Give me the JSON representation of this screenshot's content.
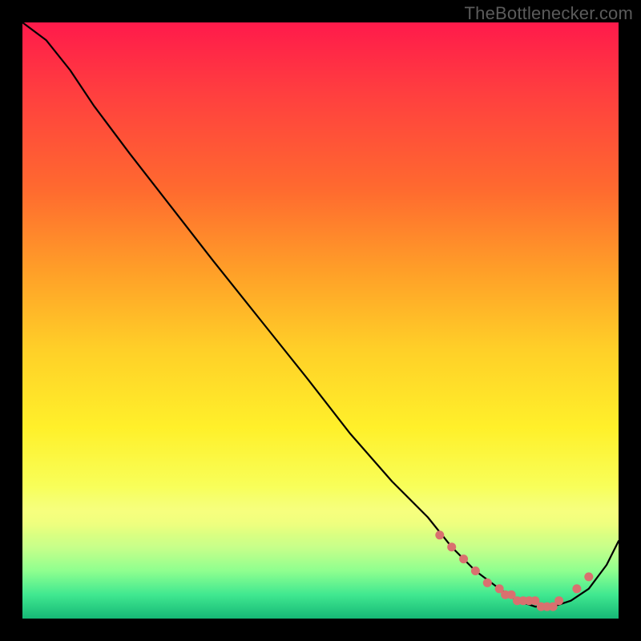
{
  "watermark": "TheBottlenecker.com",
  "chart_data": {
    "type": "line",
    "title": "",
    "xlabel": "",
    "ylabel": "",
    "xlim": [
      0,
      100
    ],
    "ylim": [
      0,
      100
    ],
    "grid": false,
    "series": [
      {
        "name": "curve",
        "x": [
          0,
          4,
          8,
          12,
          18,
          25,
          32,
          40,
          48,
          55,
          62,
          68,
          72,
          76,
          80,
          83,
          86,
          89,
          92,
          95,
          98,
          100
        ],
        "y": [
          100,
          97,
          92,
          86,
          78,
          69,
          60,
          50,
          40,
          31,
          23,
          17,
          12,
          8,
          5,
          3,
          2,
          2,
          3,
          5,
          9,
          13
        ]
      }
    ],
    "markers": {
      "name": "dots",
      "x": [
        70,
        72,
        74,
        76,
        78,
        80,
        81,
        82,
        83,
        84,
        85,
        86,
        87,
        88,
        89,
        90,
        93,
        95
      ],
      "y": [
        14,
        12,
        10,
        8,
        6,
        5,
        4,
        4,
        3,
        3,
        3,
        3,
        2,
        2,
        2,
        3,
        5,
        7
      ]
    }
  }
}
